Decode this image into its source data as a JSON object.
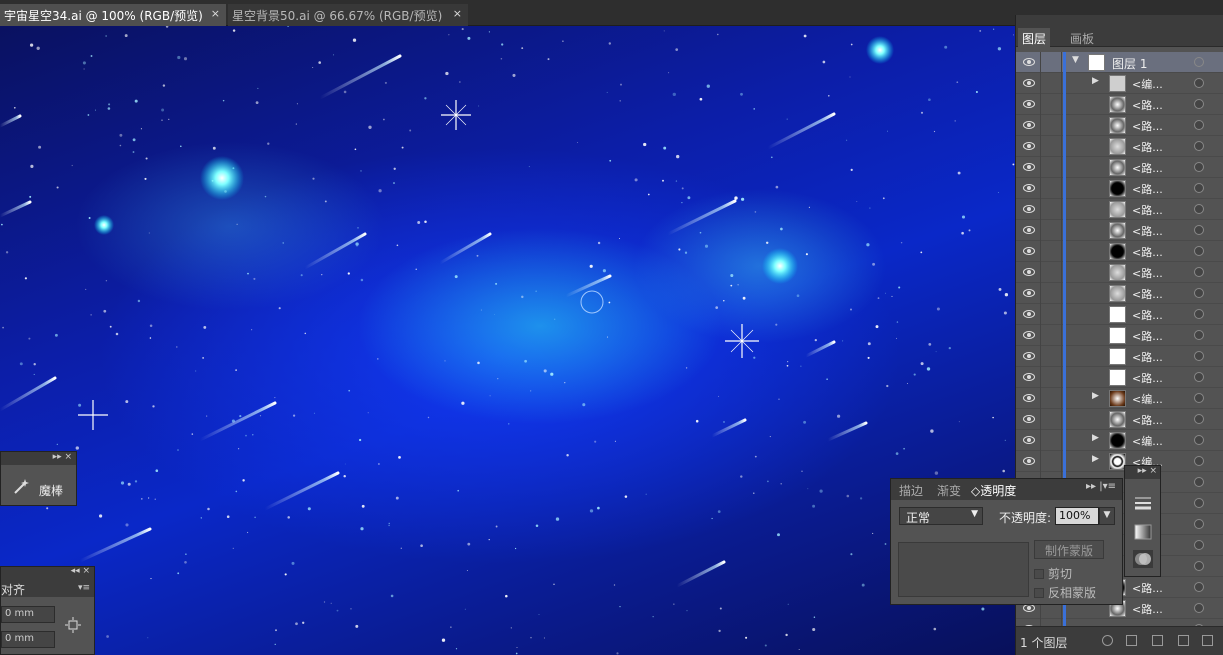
{
  "tabs": [
    {
      "label": "宇宙星空34.ai @ 100% (RGB/预览)",
      "active": true
    },
    {
      "label": "星空背景50.ai @ 66.67% (RGB/预览)",
      "active": false
    }
  ],
  "close_glyph": "×",
  "layers_panel": {
    "tabs": [
      "图层",
      "画板"
    ],
    "top_layer": "图层 1",
    "rows": [
      {
        "label": "<编...",
        "arrow": "▶",
        "thumb": "gray"
      },
      {
        "label": "<路...",
        "arrow": "",
        "thumb": "radial-dark"
      },
      {
        "label": "<路...",
        "arrow": "",
        "thumb": "radial-dark"
      },
      {
        "label": "<路...",
        "arrow": "",
        "thumb": "radial-light"
      },
      {
        "label": "<路...",
        "arrow": "",
        "thumb": "radial-dark"
      },
      {
        "label": "<路...",
        "arrow": "",
        "thumb": "radial-black"
      },
      {
        "label": "<路...",
        "arrow": "",
        "thumb": "radial-light"
      },
      {
        "label": "<路...",
        "arrow": "",
        "thumb": "radial-dark"
      },
      {
        "label": "<路...",
        "arrow": "",
        "thumb": "radial-black"
      },
      {
        "label": "<路...",
        "arrow": "",
        "thumb": "radial-light"
      },
      {
        "label": "<路...",
        "arrow": "",
        "thumb": "radial-light"
      },
      {
        "label": "<路...",
        "arrow": "",
        "thumb": "white"
      },
      {
        "label": "<路...",
        "arrow": "",
        "thumb": "white"
      },
      {
        "label": "<路...",
        "arrow": "",
        "thumb": "white"
      },
      {
        "label": "<路...",
        "arrow": "",
        "thumb": "white"
      },
      {
        "label": "<编...",
        "arrow": "▶",
        "thumb": "brown"
      },
      {
        "label": "<路...",
        "arrow": "",
        "thumb": "radial-dark"
      },
      {
        "label": "<编...",
        "arrow": "▶",
        "thumb": "radial-black"
      },
      {
        "label": "<编...",
        "arrow": "▶",
        "thumb": "ring"
      },
      {
        "label": "",
        "arrow": "",
        "thumb": "none"
      },
      {
        "label": "",
        "arrow": "",
        "thumb": "none"
      },
      {
        "label": "",
        "arrow": "",
        "thumb": "none"
      },
      {
        "label": "",
        "arrow": "",
        "thumb": "none"
      },
      {
        "label": "",
        "arrow": "",
        "thumb": "none"
      },
      {
        "label": "<路...",
        "arrow": "",
        "thumb": "radial-black"
      },
      {
        "label": "<路...",
        "arrow": "",
        "thumb": "radial-dark"
      },
      {
        "label": "",
        "arrow": "",
        "thumb": "none"
      }
    ],
    "footer_count": "1 个图层"
  },
  "transparency_panel": {
    "tabs": [
      "描边",
      "渐变",
      "◇透明度"
    ],
    "menu_glyph": "▸▸ |▾≡",
    "blend_mode": "正常",
    "opacity_label": "不透明度:",
    "opacity_value": "100%",
    "make_mask_button": "制作蒙版",
    "clip_label": "剪切",
    "invert_mask_label": "反相蒙版"
  },
  "wand_panel": {
    "label": "魔棒",
    "header": "▸▸  ×"
  },
  "align_panel": {
    "header": "◂◂  ×",
    "tab": "对齐",
    "field1": "0 mm",
    "field2": "0 mm"
  },
  "tool_strip": {
    "header": "▸▸ ×"
  },
  "colors": {
    "panel_bg": "#535353",
    "panel_header": "#3c3c3c",
    "selection_blue": "#3a70d8",
    "canvas_deep_blue": "#0a28c8",
    "nebula_cyan": "#28dcf0"
  }
}
